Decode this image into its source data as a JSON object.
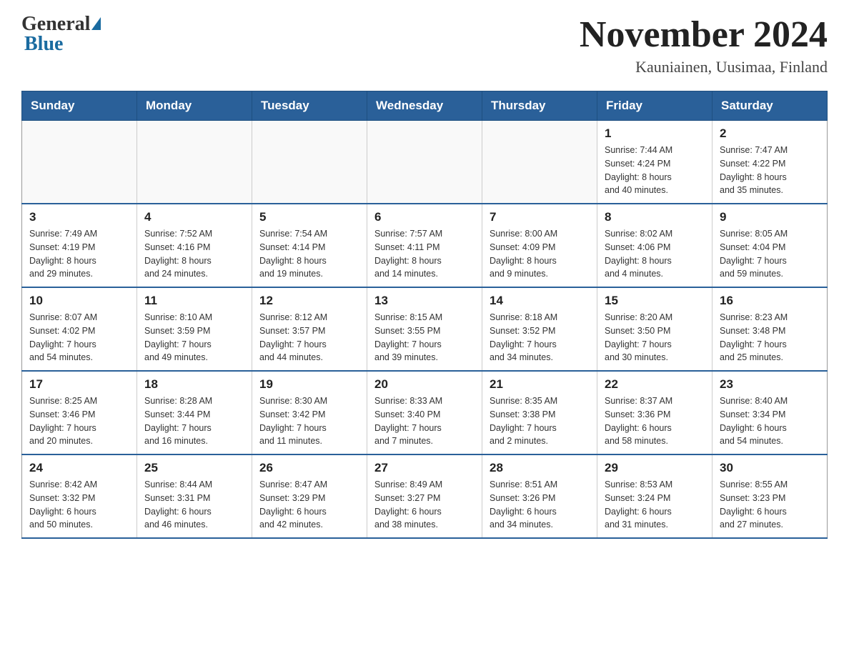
{
  "logo": {
    "text_general": "General",
    "text_blue": "Blue"
  },
  "title": "November 2024",
  "subtitle": "Kauniainen, Uusimaa, Finland",
  "weekdays": [
    "Sunday",
    "Monday",
    "Tuesday",
    "Wednesday",
    "Thursday",
    "Friday",
    "Saturday"
  ],
  "weeks": [
    [
      {
        "day": "",
        "info": ""
      },
      {
        "day": "",
        "info": ""
      },
      {
        "day": "",
        "info": ""
      },
      {
        "day": "",
        "info": ""
      },
      {
        "day": "",
        "info": ""
      },
      {
        "day": "1",
        "info": "Sunrise: 7:44 AM\nSunset: 4:24 PM\nDaylight: 8 hours\nand 40 minutes."
      },
      {
        "day": "2",
        "info": "Sunrise: 7:47 AM\nSunset: 4:22 PM\nDaylight: 8 hours\nand 35 minutes."
      }
    ],
    [
      {
        "day": "3",
        "info": "Sunrise: 7:49 AM\nSunset: 4:19 PM\nDaylight: 8 hours\nand 29 minutes."
      },
      {
        "day": "4",
        "info": "Sunrise: 7:52 AM\nSunset: 4:16 PM\nDaylight: 8 hours\nand 24 minutes."
      },
      {
        "day": "5",
        "info": "Sunrise: 7:54 AM\nSunset: 4:14 PM\nDaylight: 8 hours\nand 19 minutes."
      },
      {
        "day": "6",
        "info": "Sunrise: 7:57 AM\nSunset: 4:11 PM\nDaylight: 8 hours\nand 14 minutes."
      },
      {
        "day": "7",
        "info": "Sunrise: 8:00 AM\nSunset: 4:09 PM\nDaylight: 8 hours\nand 9 minutes."
      },
      {
        "day": "8",
        "info": "Sunrise: 8:02 AM\nSunset: 4:06 PM\nDaylight: 8 hours\nand 4 minutes."
      },
      {
        "day": "9",
        "info": "Sunrise: 8:05 AM\nSunset: 4:04 PM\nDaylight: 7 hours\nand 59 minutes."
      }
    ],
    [
      {
        "day": "10",
        "info": "Sunrise: 8:07 AM\nSunset: 4:02 PM\nDaylight: 7 hours\nand 54 minutes."
      },
      {
        "day": "11",
        "info": "Sunrise: 8:10 AM\nSunset: 3:59 PM\nDaylight: 7 hours\nand 49 minutes."
      },
      {
        "day": "12",
        "info": "Sunrise: 8:12 AM\nSunset: 3:57 PM\nDaylight: 7 hours\nand 44 minutes."
      },
      {
        "day": "13",
        "info": "Sunrise: 8:15 AM\nSunset: 3:55 PM\nDaylight: 7 hours\nand 39 minutes."
      },
      {
        "day": "14",
        "info": "Sunrise: 8:18 AM\nSunset: 3:52 PM\nDaylight: 7 hours\nand 34 minutes."
      },
      {
        "day": "15",
        "info": "Sunrise: 8:20 AM\nSunset: 3:50 PM\nDaylight: 7 hours\nand 30 minutes."
      },
      {
        "day": "16",
        "info": "Sunrise: 8:23 AM\nSunset: 3:48 PM\nDaylight: 7 hours\nand 25 minutes."
      }
    ],
    [
      {
        "day": "17",
        "info": "Sunrise: 8:25 AM\nSunset: 3:46 PM\nDaylight: 7 hours\nand 20 minutes."
      },
      {
        "day": "18",
        "info": "Sunrise: 8:28 AM\nSunset: 3:44 PM\nDaylight: 7 hours\nand 16 minutes."
      },
      {
        "day": "19",
        "info": "Sunrise: 8:30 AM\nSunset: 3:42 PM\nDaylight: 7 hours\nand 11 minutes."
      },
      {
        "day": "20",
        "info": "Sunrise: 8:33 AM\nSunset: 3:40 PM\nDaylight: 7 hours\nand 7 minutes."
      },
      {
        "day": "21",
        "info": "Sunrise: 8:35 AM\nSunset: 3:38 PM\nDaylight: 7 hours\nand 2 minutes."
      },
      {
        "day": "22",
        "info": "Sunrise: 8:37 AM\nSunset: 3:36 PM\nDaylight: 6 hours\nand 58 minutes."
      },
      {
        "day": "23",
        "info": "Sunrise: 8:40 AM\nSunset: 3:34 PM\nDaylight: 6 hours\nand 54 minutes."
      }
    ],
    [
      {
        "day": "24",
        "info": "Sunrise: 8:42 AM\nSunset: 3:32 PM\nDaylight: 6 hours\nand 50 minutes."
      },
      {
        "day": "25",
        "info": "Sunrise: 8:44 AM\nSunset: 3:31 PM\nDaylight: 6 hours\nand 46 minutes."
      },
      {
        "day": "26",
        "info": "Sunrise: 8:47 AM\nSunset: 3:29 PM\nDaylight: 6 hours\nand 42 minutes."
      },
      {
        "day": "27",
        "info": "Sunrise: 8:49 AM\nSunset: 3:27 PM\nDaylight: 6 hours\nand 38 minutes."
      },
      {
        "day": "28",
        "info": "Sunrise: 8:51 AM\nSunset: 3:26 PM\nDaylight: 6 hours\nand 34 minutes."
      },
      {
        "day": "29",
        "info": "Sunrise: 8:53 AM\nSunset: 3:24 PM\nDaylight: 6 hours\nand 31 minutes."
      },
      {
        "day": "30",
        "info": "Sunrise: 8:55 AM\nSunset: 3:23 PM\nDaylight: 6 hours\nand 27 minutes."
      }
    ]
  ]
}
